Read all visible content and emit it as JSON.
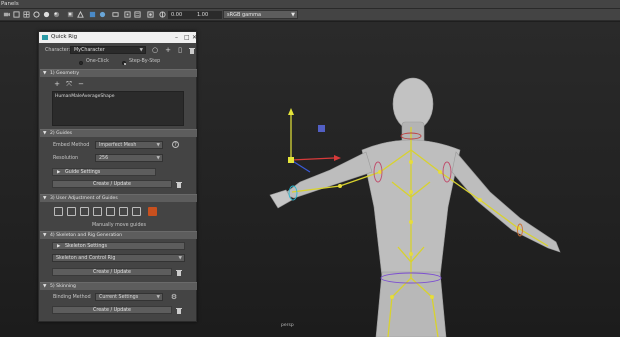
{
  "menubar": {
    "label": "Panels"
  },
  "toolbar": {
    "near_value": "0.00",
    "far_value": "1.00",
    "color_space": "sRGB gamma",
    "icons": [
      "camera-icon",
      "frame-icon",
      "grid-icon",
      "wireframe-icon",
      "shaded-icon",
      "lighting-icon",
      "shadow-icon",
      "xray-icon",
      "isolate-icon",
      "resolution-gate-icon",
      "film-gate-icon",
      "safe-action-icon",
      "hud-icon"
    ]
  },
  "viewport": {
    "camera_label": "persp"
  },
  "quick_rig": {
    "title": "Quick Rig",
    "character_label": "Character:",
    "character_value": "MyCharacter",
    "mode_one_click": "One-Click",
    "mode_step_by_step": "Step-By-Step",
    "selected_mode": "Step-By-Step",
    "section_geometry": "1) Geometry",
    "geometry_item": "HumanMaleAverageShape",
    "section_guides": "2) Guides",
    "embed_method_label": "Embed Method",
    "embed_method_value": "Imperfect Mesh",
    "resolution_label": "Resolution",
    "resolution_value": "256",
    "guide_settings_label": "Guide Settings",
    "create_update_guides": "Create / Update",
    "section_user_adjustment": "3) User Adjustment of Guides",
    "manually_move_guides": "Manually move guides",
    "section_skeleton": "4) Skeleton and Rig Generation",
    "skeleton_settings_label": "Skeleton Settings",
    "skeleton_type_value": "Skeleton and Control Rig",
    "create_update_skeleton": "Create / Update",
    "section_skinning": "5) Skinning",
    "binding_method_label": "Binding Method",
    "binding_method_value": "Current Settings",
    "create_update_skin": "Create / Update"
  }
}
